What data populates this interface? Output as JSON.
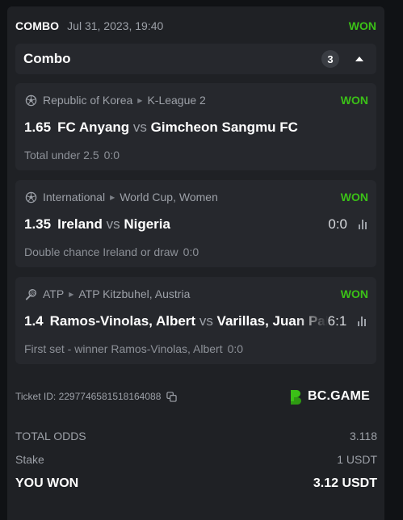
{
  "header": {
    "type": "COMBO",
    "date": "Jul 31, 2023, 19:40",
    "status": "WON"
  },
  "combo": {
    "title": "Combo",
    "count": "3"
  },
  "selections": [
    {
      "sport_icon": "soccer-ball-icon",
      "country": "Republic of Korea",
      "league": "K-League 2",
      "status": "WON",
      "odds": "1.65",
      "home": "FC Anyang",
      "vs": "vs",
      "away": "Gimcheon Sangmu FC",
      "score": "",
      "market": "Total under 2.5",
      "final": "0:0"
    },
    {
      "sport_icon": "soccer-ball-icon",
      "country": "International",
      "league": "World Cup, Women",
      "status": "WON",
      "odds": "1.35",
      "home": "Ireland",
      "vs": "vs",
      "away": "Nigeria",
      "score": "0:0",
      "market": "Double chance Ireland or draw",
      "final": "0:0"
    },
    {
      "sport_icon": "tennis-racket-icon",
      "country": "ATP",
      "league": "ATP Kitzbuhel, Austria",
      "status": "WON",
      "odds": "1.4",
      "home": "Ramos-Vinolas, Albert",
      "vs": "vs",
      "away": "Varillas, Juan Pablo",
      "score": "6:1",
      "market": "First set - winner Ramos-Vinolas, Albert",
      "final": "0:0"
    }
  ],
  "ticket": {
    "label": "Ticket ID:",
    "id": "2297746581518164088"
  },
  "brand": {
    "name": "BC.GAME",
    "color": "#3bc117"
  },
  "summary": {
    "total_odds_label": "TOTAL ODDS",
    "total_odds": "3.118",
    "stake_label": "Stake",
    "stake": "1 USDT",
    "won_label": "YOU WON",
    "won": "3.12 USDT"
  },
  "colors": {
    "won": "#3bc117",
    "card": "#1f2125",
    "panel": "#26282d",
    "muted": "#9da1a8"
  }
}
